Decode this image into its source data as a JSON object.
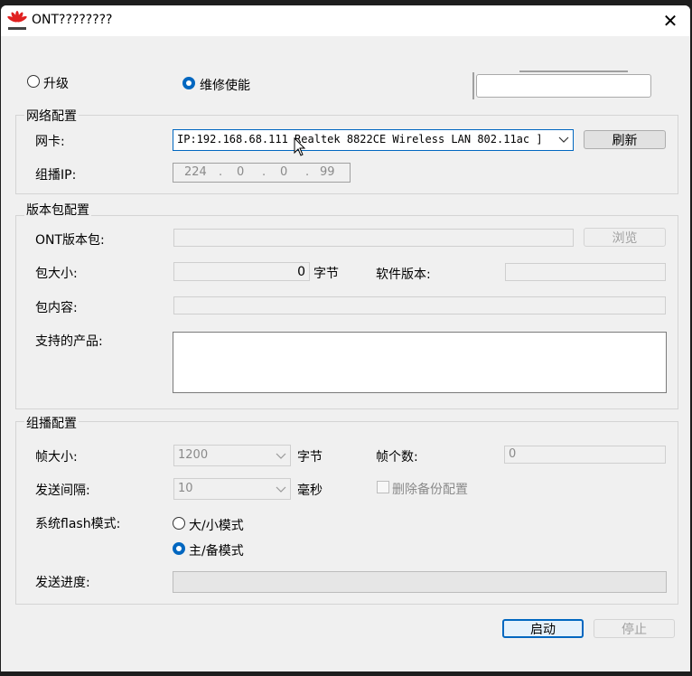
{
  "window": {
    "title": "ONT????????",
    "close_glyph": "✕"
  },
  "mode": {
    "upgrade_label": "升级",
    "repair_label": "维修使能",
    "selected": "repair"
  },
  "network": {
    "group_label": "网络配置",
    "nic_label": "网卡:",
    "nic_value": "IP:192.168.68.111 Realtek 8822CE Wireless LAN 802.11ac ]",
    "refresh_label": "刷新",
    "multicast_ip_label": "组播IP:",
    "ip_octets": [
      "224",
      "0",
      "0",
      "99"
    ],
    "ip_sep": "."
  },
  "package": {
    "group_label": "版本包配置",
    "ont_pkg_label": "ONT版本包:",
    "browse_label": "浏览",
    "size_label": "包大小:",
    "size_value": "0",
    "size_unit": "字节",
    "sw_version_label": "软件版本:",
    "content_label": "包内容:",
    "products_label": "支持的产品:"
  },
  "multicast": {
    "group_label": "组播配置",
    "frame_size_label": "帧大小:",
    "frame_size_value": "1200",
    "frame_size_unit": "字节",
    "frame_count_label": "帧个数:",
    "frame_count_value": "0",
    "interval_label": "发送间隔:",
    "interval_value": "10",
    "interval_unit": "毫秒",
    "delete_backup_label": "删除备份配置",
    "flash_mode_label": "系统flash模式:",
    "flash_big_small_label": "大/小模式",
    "flash_main_backup_label": "主/备模式",
    "flash_selected": "main_backup",
    "progress_label": "发送进度:",
    "progress": 0
  },
  "actions": {
    "start_label": "启动",
    "stop_label": "停止"
  }
}
